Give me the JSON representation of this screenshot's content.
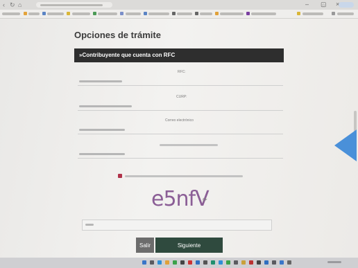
{
  "page": {
    "title": "Opciones de trámite",
    "section_header": "»Contribuyente que cuenta con RFC"
  },
  "form": {
    "rfc_label": "RFC:",
    "curp_label": "CURP:",
    "email_label": "Correo electrónico"
  },
  "captcha": {
    "text": "e5nfV",
    "refresh_icon": "refresh-icon"
  },
  "buttons": {
    "exit": "Salir",
    "next": "Siguiente"
  },
  "colors": {
    "section_bar": "#2e2e2e",
    "next_button": "#2f4a3e",
    "exit_button": "#6c6c6c",
    "checkbox": "#b0324a",
    "captcha": "#8b5e96",
    "arrow": "#4a90d9"
  }
}
